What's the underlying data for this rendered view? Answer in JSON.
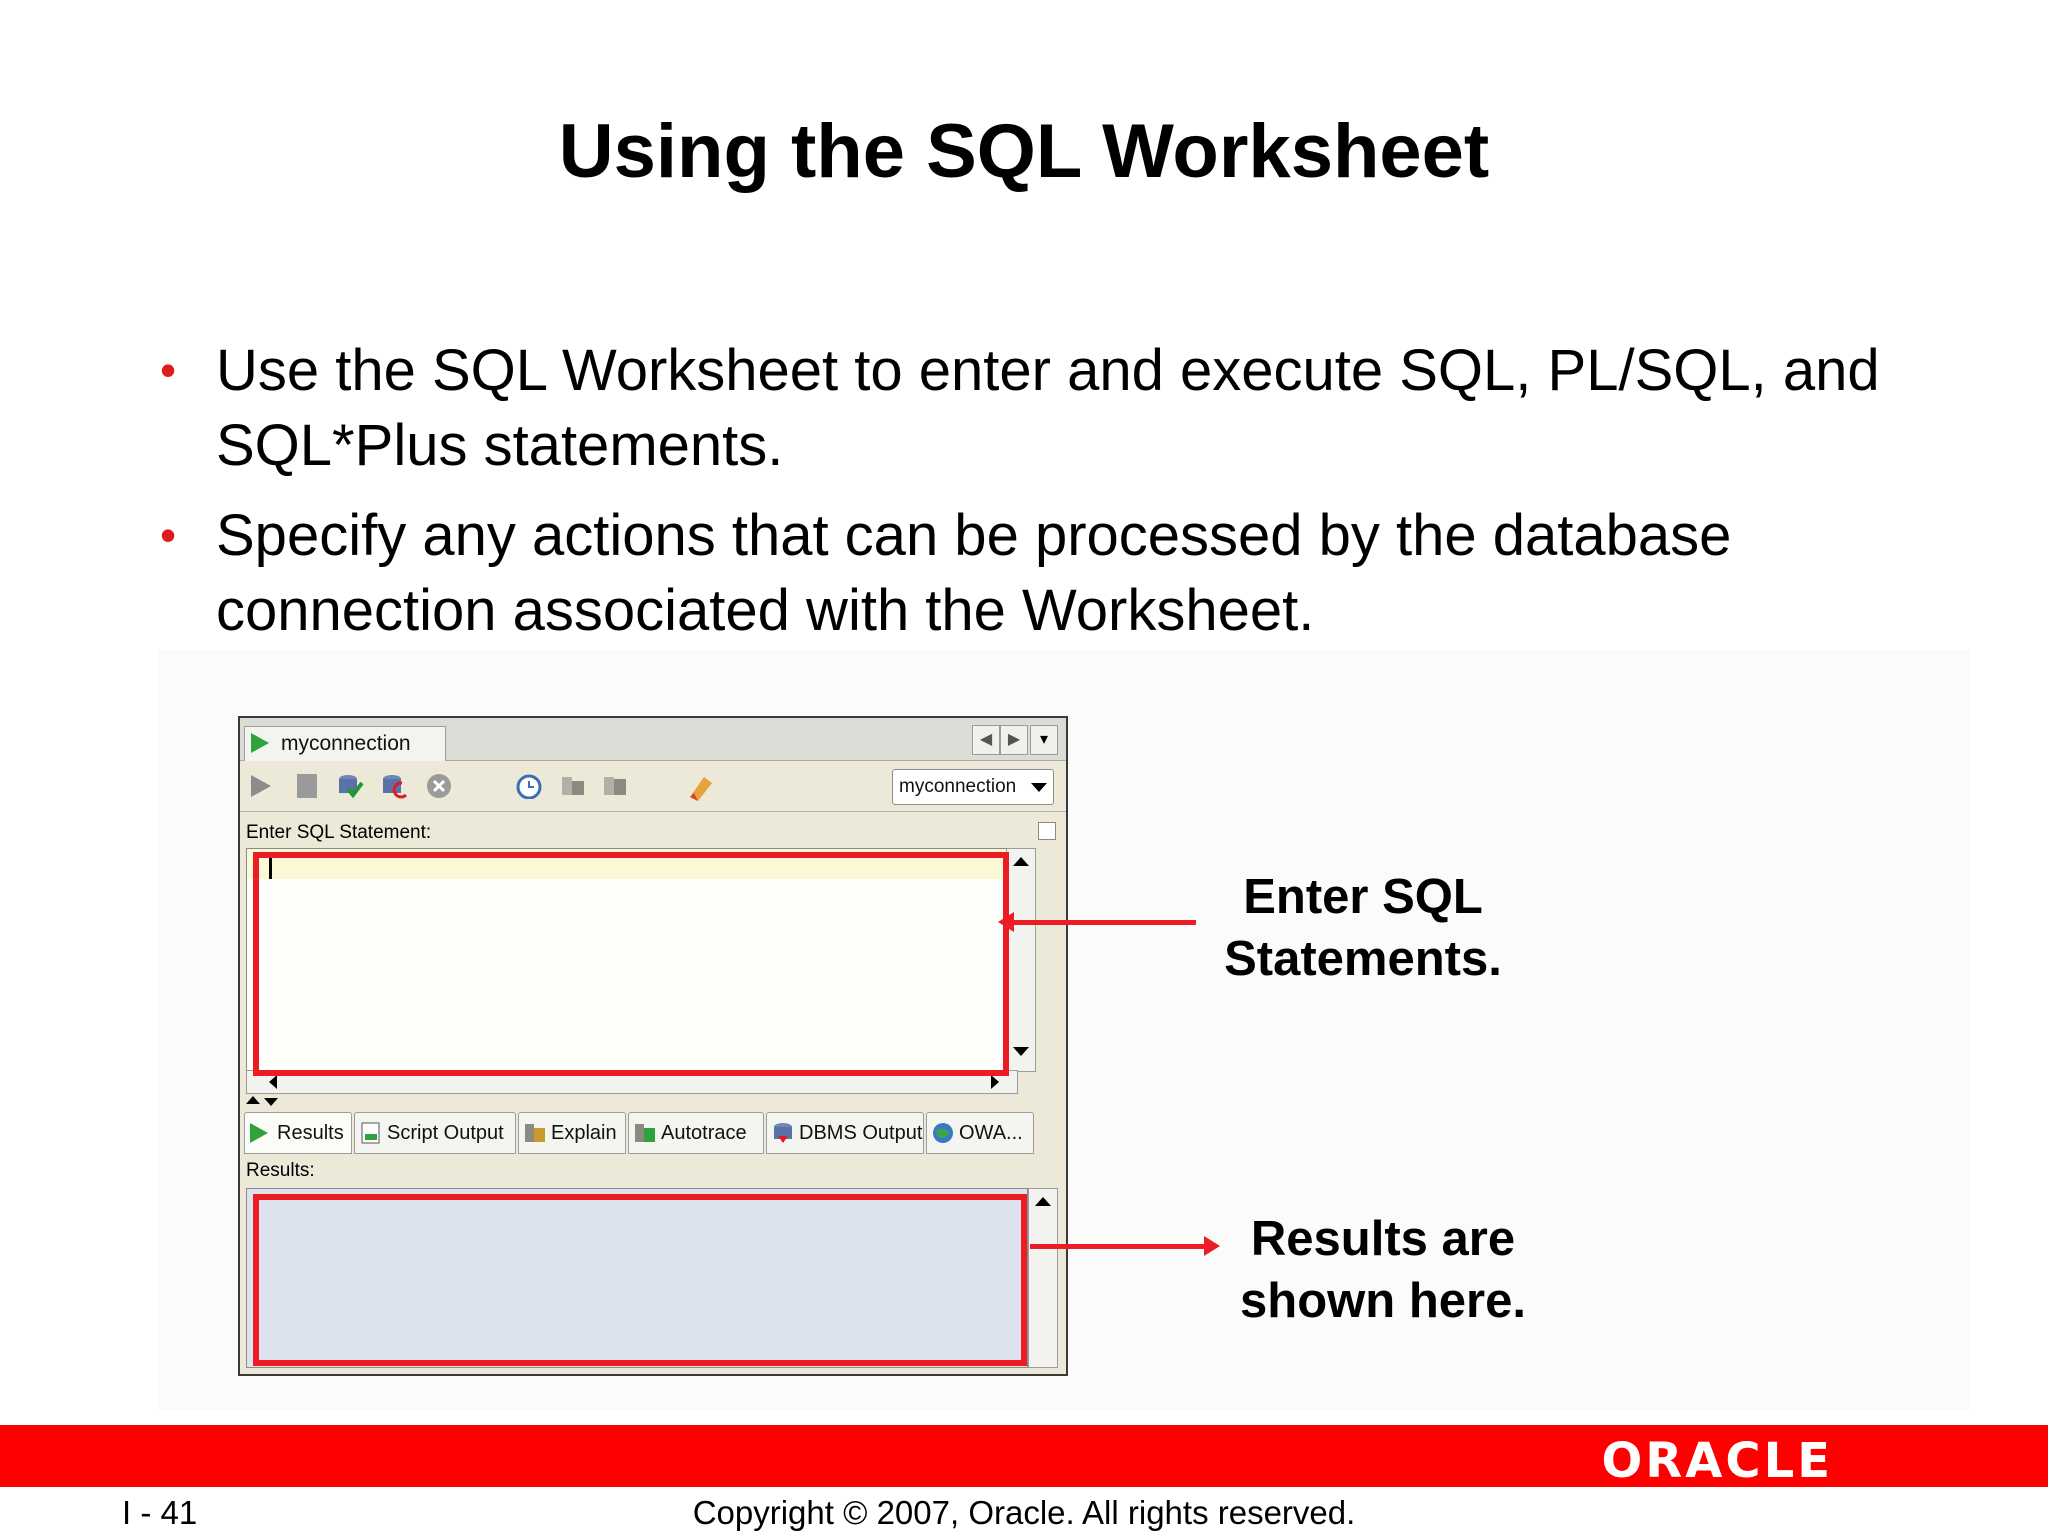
{
  "slide": {
    "title": "Using the SQL Worksheet",
    "bullets": [
      "Use the SQL Worksheet to enter and execute SQL, PL/SQL, and SQL*Plus statements.",
      "Specify any actions that can be processed by the database connection associated with the Worksheet."
    ],
    "bullet_symbol": "•"
  },
  "worksheet": {
    "tab_label": "myconnection",
    "nav": {
      "prev": "◀",
      "next": "▶",
      "menu": "▾"
    },
    "connection_select": "myconnection",
    "toolbar_icons": [
      "execute-statement-icon",
      "run-script-icon",
      "commit-icon",
      "rollback-icon",
      "cancel-icon",
      "sql-history-icon",
      "explain-plan-icon",
      "autotrace-icon",
      "clear-icon"
    ],
    "sql_label": "Enter SQL Statement:",
    "results_label": "Results:",
    "result_tabs": [
      "Results",
      "Script Output",
      "Explain",
      "Autotrace",
      "DBMS Output",
      "OWA..."
    ]
  },
  "callouts": {
    "sql": "Enter SQL Statements.",
    "results": "Results are shown here."
  },
  "footer": {
    "page": "I - 41",
    "copyright": "Copyright © 2007, Oracle. All rights reserved.",
    "logo": "ORACLE"
  },
  "colors": {
    "accent_red": "#ec1c24",
    "footer_red": "#ff0000",
    "bullet_red": "#e0191d"
  }
}
